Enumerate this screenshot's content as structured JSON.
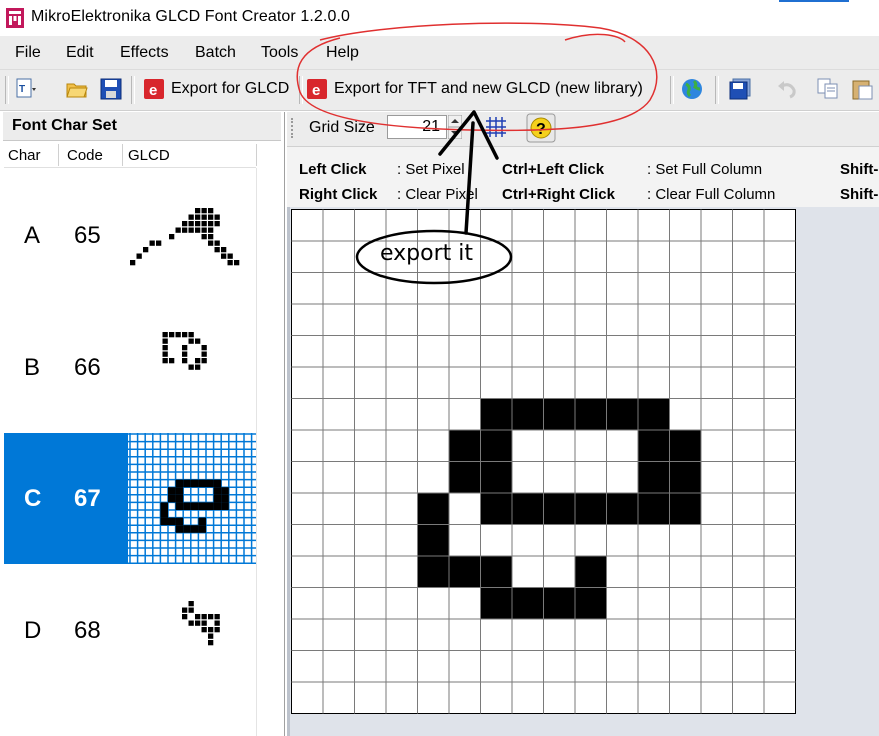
{
  "window": {
    "title": "MikroElektronika GLCD Font Creator 1.2.0.0"
  },
  "menu": [
    "File",
    "Edit",
    "Effects",
    "Batch",
    "Tools",
    "Help"
  ],
  "toolbar": {
    "export_glcd_label": "Export for GLCD",
    "export_tft_label": "Export for TFT and new GLCD (new library)"
  },
  "left_panel": {
    "title": "Font Char Set",
    "columns": [
      "Char",
      "Code",
      "GLCD"
    ],
    "rows": [
      {
        "char": "A",
        "code": "65",
        "selected": false
      },
      {
        "char": "B",
        "code": "66",
        "selected": false
      },
      {
        "char": "C",
        "code": "67",
        "selected": true
      },
      {
        "char": "D",
        "code": "68",
        "selected": false
      }
    ]
  },
  "editor": {
    "grid_size_label": "Grid Size",
    "grid_size_value": "21",
    "instructions": [
      {
        "action": "Left Click",
        "result": ": Set Pixel"
      },
      {
        "action": "Right Click",
        "result": ": Clear Pixel"
      },
      {
        "action": "Ctrl+Left Click",
        "result": ": Set Full Column"
      },
      {
        "action": "Ctrl+Right Click",
        "result": ": Clear Full Column"
      },
      {
        "action": "Shift-",
        "result": ""
      },
      {
        "action": "Shift-",
        "result": ""
      }
    ],
    "grid_columns": 16,
    "grid_rows": 16,
    "pixels": [
      [
        6,
        6
      ],
      [
        7,
        6
      ],
      [
        8,
        6
      ],
      [
        9,
        6
      ],
      [
        10,
        6
      ],
      [
        11,
        6
      ],
      [
        5,
        7
      ],
      [
        6,
        7
      ],
      [
        11,
        7
      ],
      [
        12,
        7
      ],
      [
        5,
        8
      ],
      [
        6,
        8
      ],
      [
        11,
        8
      ],
      [
        12,
        8
      ],
      [
        4,
        9
      ],
      [
        6,
        9
      ],
      [
        7,
        9
      ],
      [
        8,
        9
      ],
      [
        9,
        9
      ],
      [
        10,
        9
      ],
      [
        11,
        9
      ],
      [
        12,
        9
      ],
      [
        4,
        10
      ],
      [
        4,
        11
      ],
      [
        5,
        11
      ],
      [
        6,
        11
      ],
      [
        9,
        11
      ],
      [
        6,
        12
      ],
      [
        7,
        12
      ],
      [
        8,
        12
      ],
      [
        9,
        12
      ]
    ]
  },
  "annotation": {
    "text": "export it",
    "color_circle": "#e03030",
    "color_ink": "#000000"
  },
  "colors": {
    "selection": "#0078d7",
    "menu_bg": "#ececec",
    "canvas_bg": "#dfe3ea"
  }
}
